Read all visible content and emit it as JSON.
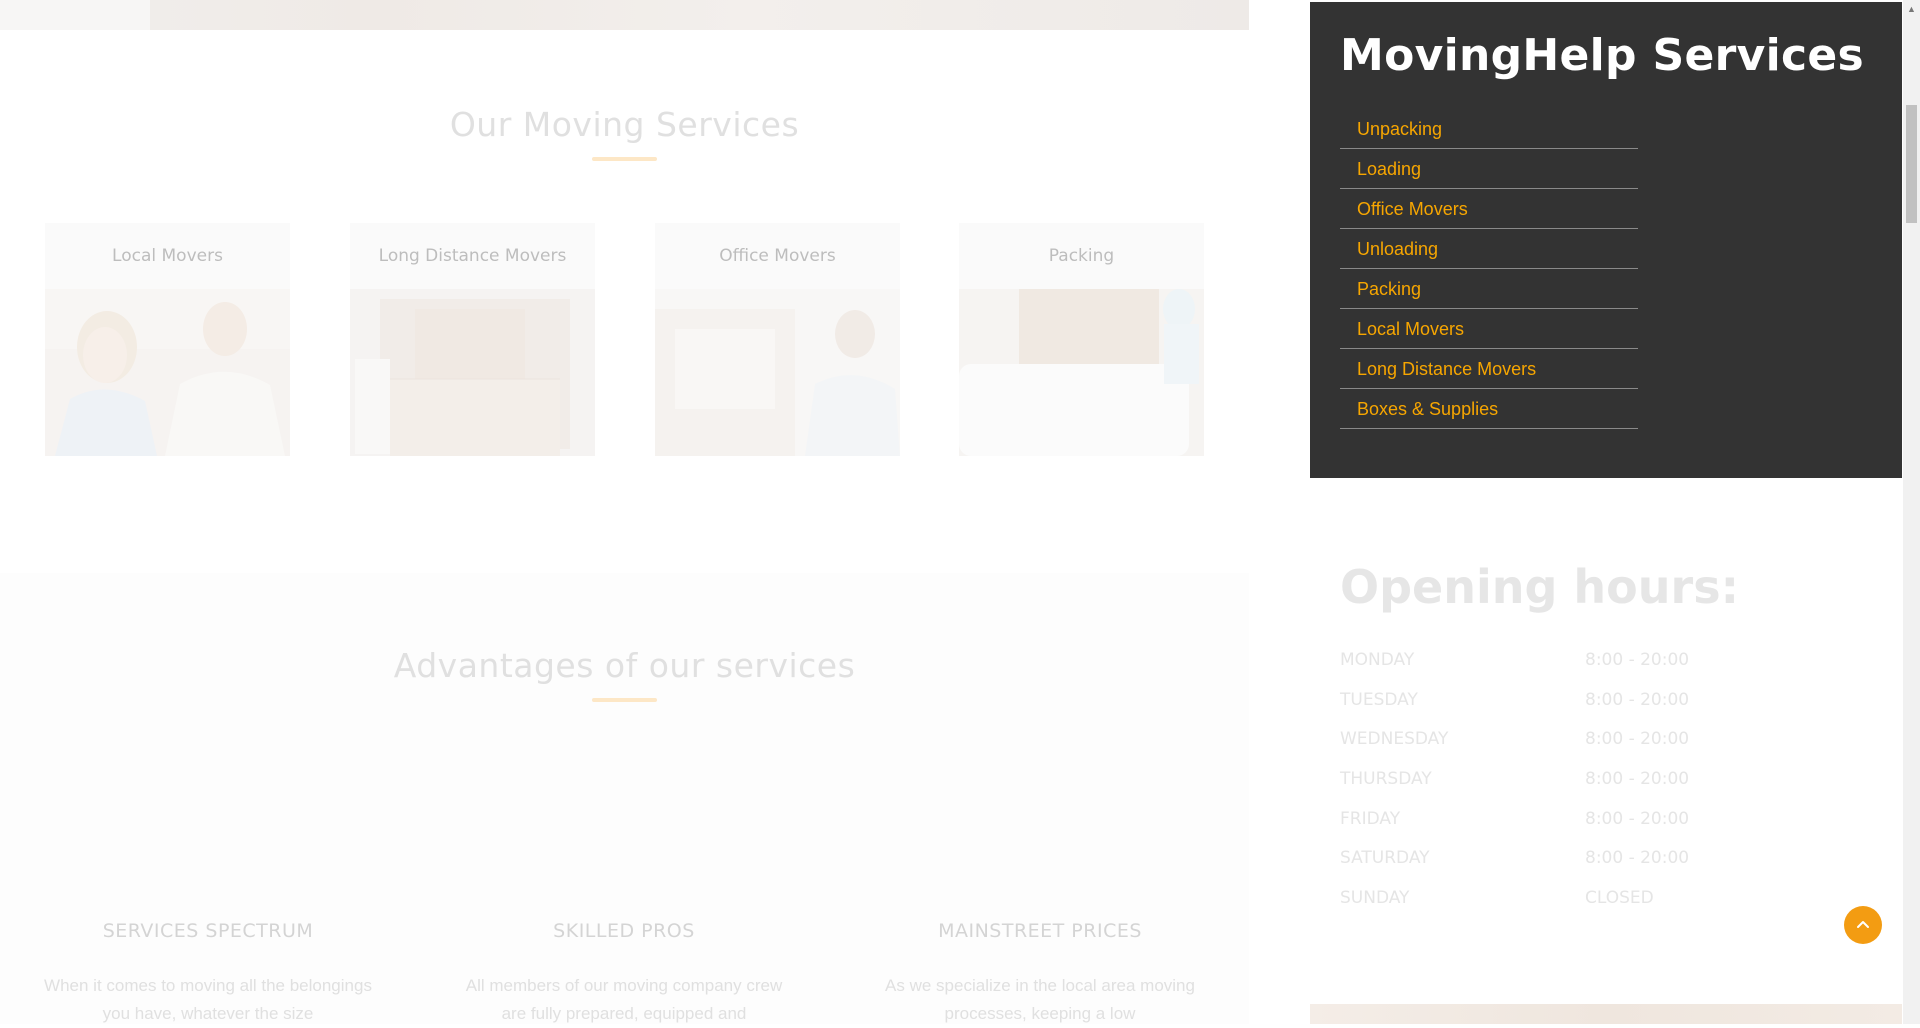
{
  "services_section": {
    "title": "Our Moving Services",
    "cards": [
      {
        "label": "Local Movers"
      },
      {
        "label": "Long Distance Movers"
      },
      {
        "label": "Office Movers"
      },
      {
        "label": "Packing"
      }
    ]
  },
  "advantages_section": {
    "title": "Advantages of our services",
    "items": [
      {
        "heading": "SERVICES SPECTRUM",
        "text": "When it comes to moving all the belongings you have, whatever the size"
      },
      {
        "heading": "SKILLED PROS",
        "text": "All members of our moving company crew are fully prepared, equipped and"
      },
      {
        "heading": "MAINSTREET PRICES",
        "text": "As we specialize in the local area moving processes, keeping a low"
      }
    ]
  },
  "sidebar": {
    "title": "MovingHelp Services",
    "links": [
      "Unpacking",
      "Loading",
      "Office Movers",
      "Unloading",
      "Packing",
      "Local Movers",
      "Long Distance Movers",
      "Boxes & Supplies"
    ],
    "link_color": "#f7a600",
    "panel_color": "#333333"
  },
  "opening_hours": {
    "title": "Opening hours:",
    "rows": [
      {
        "day": "MONDAY",
        "time": "8:00 - 20:00"
      },
      {
        "day": "TUESDAY",
        "time": "8:00 - 20:00"
      },
      {
        "day": "WEDNESDAY",
        "time": "8:00 - 20:00"
      },
      {
        "day": "THURSDAY",
        "time": "8:00 - 20:00"
      },
      {
        "day": "FRIDAY",
        "time": "8:00 - 20:00"
      },
      {
        "day": "SATURDAY",
        "time": "8:00 - 20:00"
      },
      {
        "day": "SUNDAY",
        "time": "CLOSED"
      }
    ]
  },
  "back_to_top": {
    "icon": "chevron-up-icon",
    "color": "#f39c12"
  },
  "accent_color": "#f39c12"
}
